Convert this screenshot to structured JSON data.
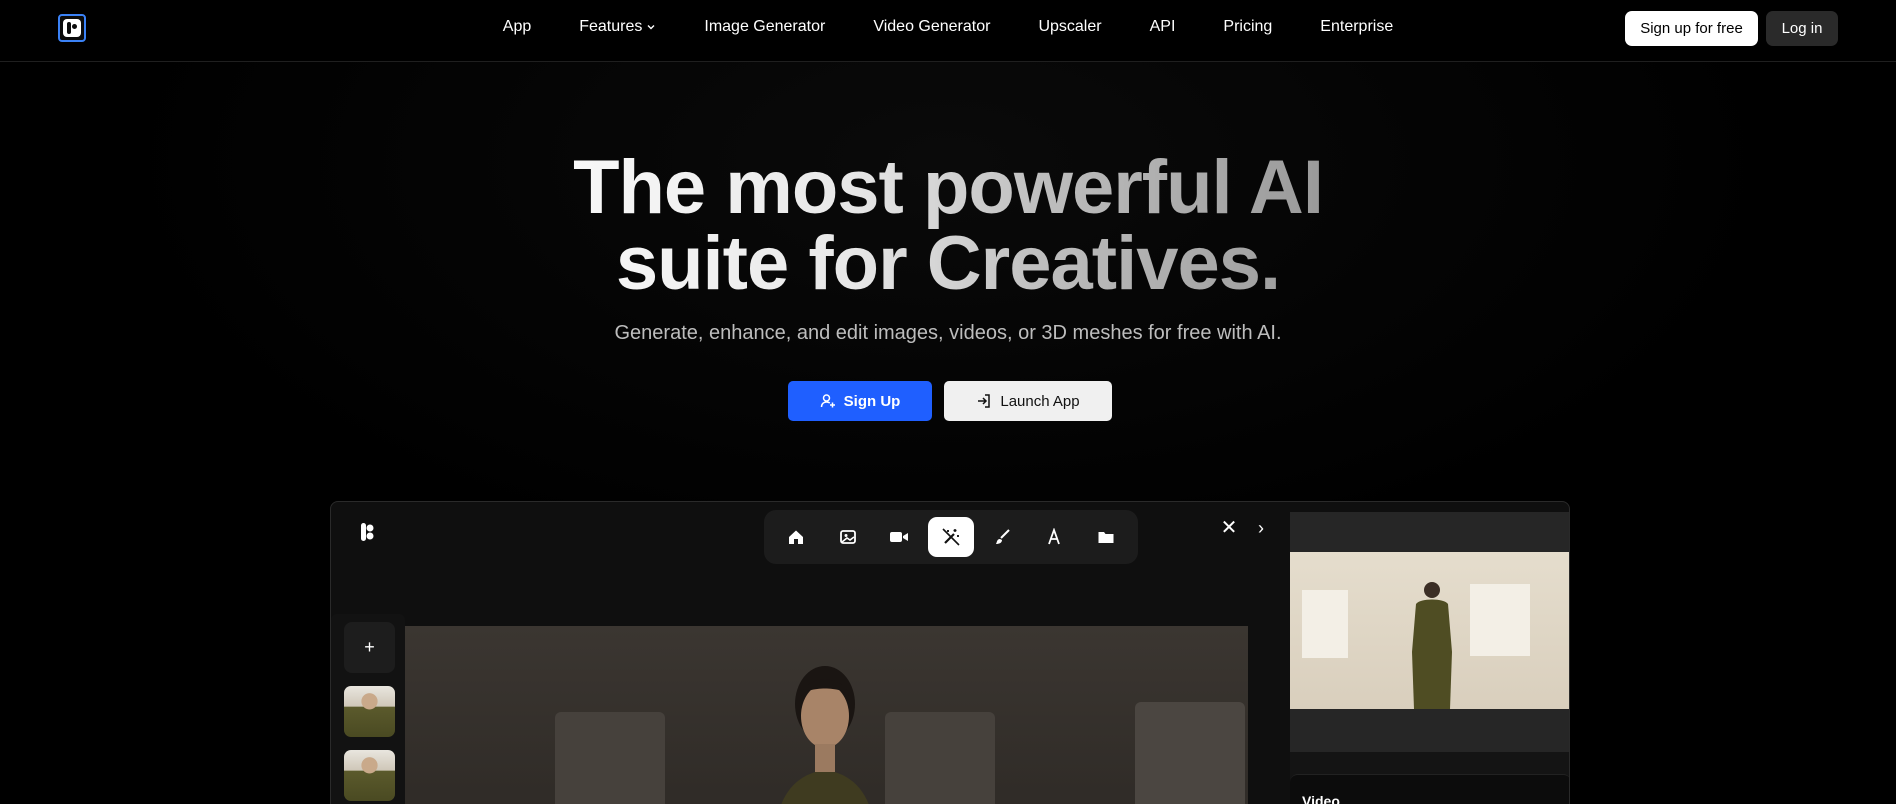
{
  "nav": {
    "links": [
      "App",
      "Features",
      "Image Generator",
      "Video Generator",
      "Upscaler",
      "API",
      "Pricing",
      "Enterprise"
    ],
    "signup_label": "Sign up for free",
    "login_label": "Log in"
  },
  "hero": {
    "title_line1": "The most powerful AI",
    "title_line2": "suite for Creatives.",
    "subtitle": "Generate, enhance, and edit images, videos, or 3D meshes for free with AI.",
    "primary_button": "Sign Up",
    "secondary_button": "Launch App"
  },
  "app": {
    "toolbar_icons": [
      "home-icon",
      "image-icon",
      "video-camera-icon",
      "magic-wand-icon",
      "brush-icon",
      "text-icon",
      "folder-icon"
    ],
    "active_tool": "magic-wand-icon",
    "add_label": "+",
    "right_panel": {
      "video_label": "Video"
    }
  },
  "colors": {
    "accent": "#1f5fff",
    "logo_border": "#3b82f6",
    "background": "#000000"
  }
}
